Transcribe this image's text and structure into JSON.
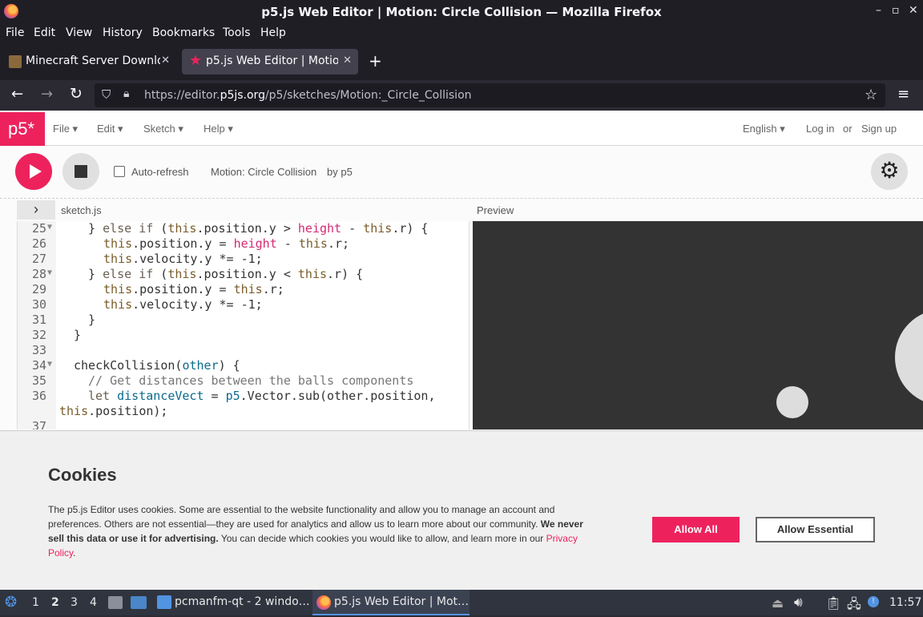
{
  "window": {
    "title": "p5.js Web Editor | Motion: Circle Collision — Mozilla Firefox"
  },
  "menubar": [
    "File",
    "Edit",
    "View",
    "History",
    "Bookmarks",
    "Tools",
    "Help"
  ],
  "tabs": [
    {
      "label": "Minecraft Server Downlo",
      "active": false
    },
    {
      "label": "p5.js Web Editor | Motion",
      "active": true
    }
  ],
  "nav": {
    "url_prefix": "https://editor.",
    "url_domain": "p5js.org",
    "url_path": "/p5/sketches/Motion:_Circle_Collision"
  },
  "p5": {
    "logo": "p5*",
    "menu": [
      "File ▾",
      "Edit ▾",
      "Sketch ▾",
      "Help ▾"
    ],
    "language": "English ▾",
    "login": "Log in",
    "or": "or",
    "signup": "Sign up",
    "auto_refresh": "Auto-refresh",
    "sketch_name": "Motion: Circle Collision",
    "sketch_by": "by p5",
    "file_name": "sketch.js",
    "preview_label": "Preview"
  },
  "code_lines": [
    {
      "n": "25",
      "fold": true
    },
    {
      "n": "26",
      "fold": false
    },
    {
      "n": "27",
      "fold": false
    },
    {
      "n": "28",
      "fold": true
    },
    {
      "n": "29",
      "fold": false
    },
    {
      "n": "30",
      "fold": false
    },
    {
      "n": "31",
      "fold": false
    },
    {
      "n": "32",
      "fold": false
    },
    {
      "n": "33",
      "fold": false
    },
    {
      "n": "34",
      "fold": true
    },
    {
      "n": "35",
      "fold": false
    },
    {
      "n": "36",
      "fold": false
    },
    {
      "n": "37",
      "fold": false
    }
  ],
  "code": {
    "l25": [
      "} ",
      "else if",
      " (",
      "this",
      ".position.y > ",
      "height",
      " - ",
      "this",
      ".r) {"
    ],
    "l26": [
      "this",
      ".position.y = ",
      "height",
      " - ",
      "this",
      ".r;"
    ],
    "l27": [
      "this",
      ".velocity.y *= -1;"
    ],
    "l28": [
      "} ",
      "else if",
      " (",
      "this",
      ".position.y < ",
      "this",
      ".r) {"
    ],
    "l29": [
      "this",
      ".position.y = ",
      "this",
      ".r;"
    ],
    "l30": [
      "this",
      ".velocity.y *= -1;"
    ],
    "l31": "}",
    "l32": "}",
    "l34": [
      "checkCollision(",
      "other",
      ") {"
    ],
    "l35": "// Get distances between the balls components",
    "l36": [
      "let ",
      "distanceVect",
      " = ",
      "p5",
      ".Vector.sub(other.position,"
    ],
    "l36b": [
      "this",
      ".position);"
    ]
  },
  "cookies": {
    "title": "Cookies",
    "text_1": "The p5.js Editor uses cookies. Some are essential to the website functionality and allow you to manage an account and preferences. Others are not essential—they are used for analytics and allow us to learn more about our community. ",
    "text_bold": "We never sell this data or use it for advertising.",
    "text_2": " You can decide which cookies you would like to allow, and learn more in our ",
    "link": "Privacy Policy",
    "text_end": ".",
    "allow_all": "Allow All",
    "allow_essential": "Allow Essential"
  },
  "taskbar": {
    "workspaces": [
      "1",
      "2",
      "3",
      "4"
    ],
    "task_1": "pcmanfm-qt - 2 windo…",
    "task_2": "p5.js Web Editor | Mot…",
    "clock": "11:57"
  },
  "colors": {
    "p5_pink": "#ed225d",
    "firefox_dark": "#1f1e25",
    "taskbar": "#2f343f"
  }
}
